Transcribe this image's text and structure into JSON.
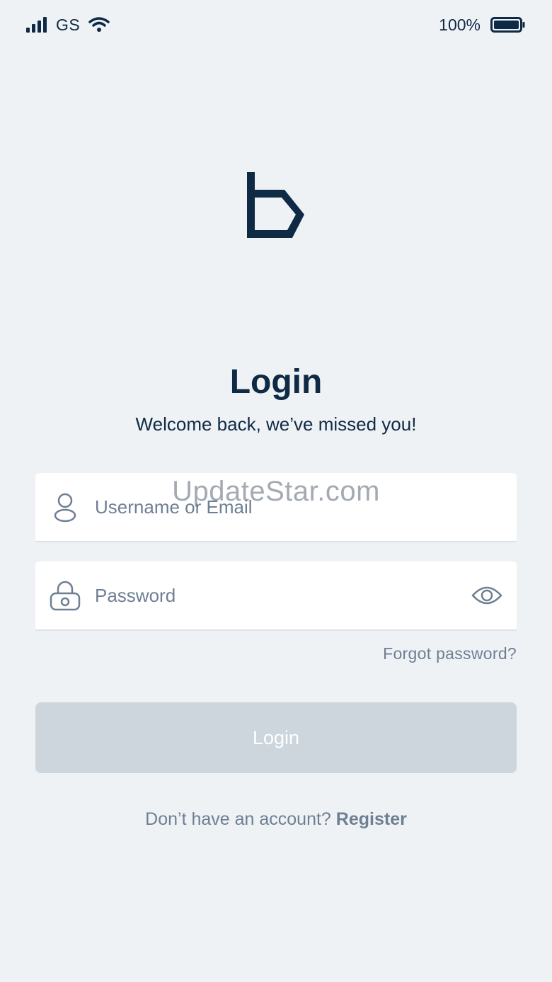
{
  "status_bar": {
    "carrier": "GS",
    "battery_percent": "100%",
    "icons": [
      "signal-icon",
      "wifi-icon",
      "battery-icon"
    ]
  },
  "logo": {
    "icon": "brand-b-logo"
  },
  "header": {
    "title": "Login",
    "subtitle": "Welcome back, we’ve missed you!"
  },
  "form": {
    "username": {
      "placeholder": "Username or Email",
      "value": "",
      "icon": "user-icon"
    },
    "password": {
      "placeholder": "Password",
      "value": "",
      "icon": "lock-icon",
      "toggle_icon": "eye-icon"
    },
    "forgot_password": "Forgot password?",
    "login_button": "Login"
  },
  "footer": {
    "prompt": "Don’t have an account?",
    "register_link": "Register"
  },
  "watermark": "UpdateStar.com",
  "colors": {
    "background": "#eff2f5",
    "primary_text": "#0f2a44",
    "muted_text": "#6e7f93",
    "button_disabled": "#cdd5dd",
    "field_bg": "#ffffff"
  }
}
